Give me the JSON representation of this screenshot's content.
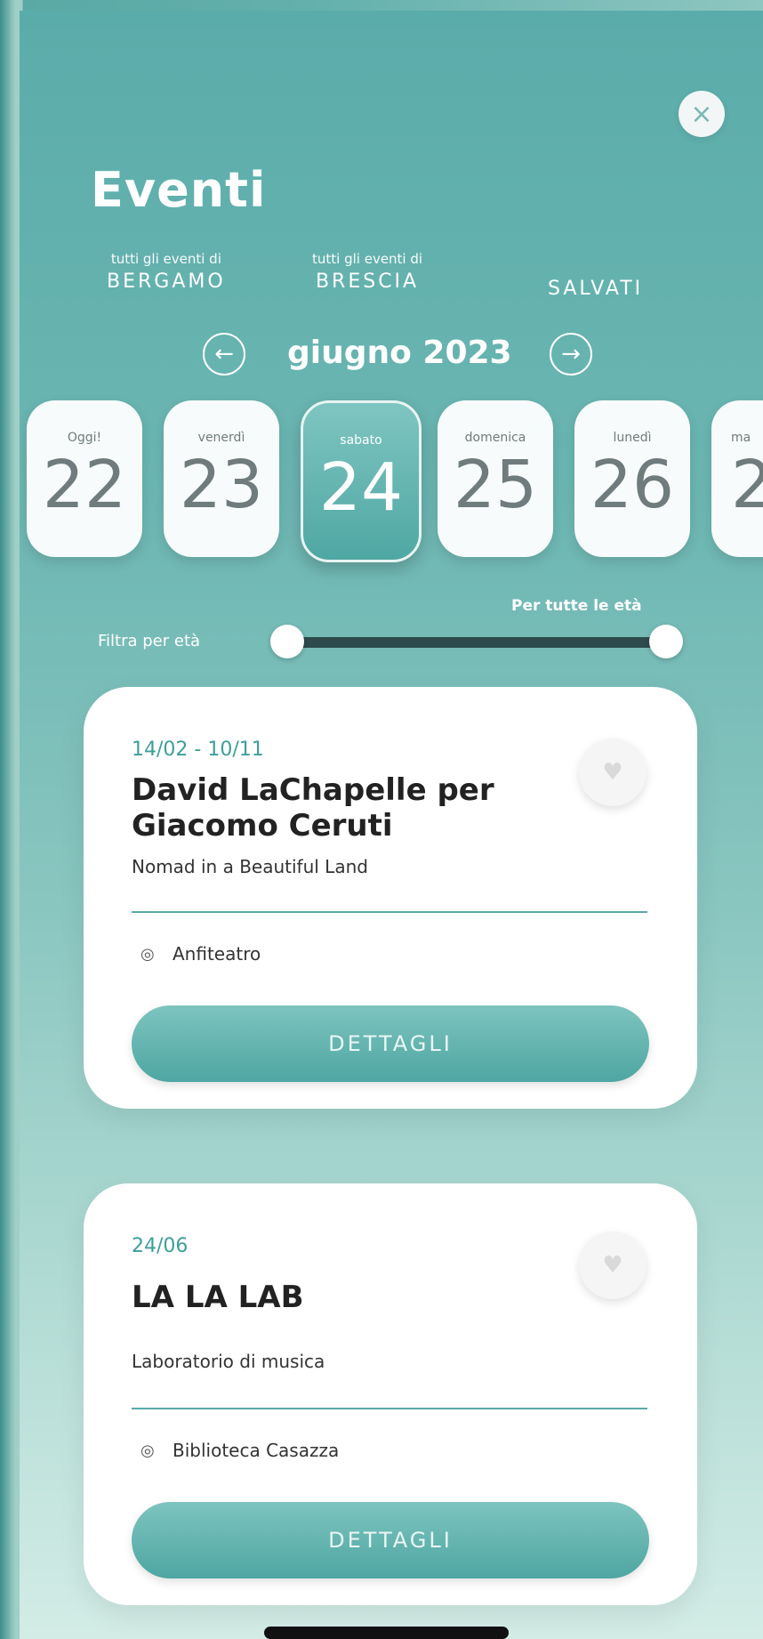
{
  "header": {
    "title": "Eventi",
    "close_icon": "close-icon",
    "tabs": [
      {
        "small": "tutti gli eventi di",
        "big": "BERGAMO"
      },
      {
        "small": "tutti gli eventi di",
        "big": "BRESCIA"
      },
      {
        "big": "SALVATI"
      }
    ]
  },
  "calendar": {
    "month": "giugno 2023",
    "days": [
      {
        "name": "Oggi!",
        "num": "22"
      },
      {
        "name": "venerdì",
        "num": "23"
      },
      {
        "name": "sabato",
        "num": "24",
        "selected": true
      },
      {
        "name": "domenica",
        "num": "25"
      },
      {
        "name": "lunedì",
        "num": "26"
      },
      {
        "name": "ma",
        "num": "2"
      }
    ]
  },
  "filter": {
    "label": "Filtra per età",
    "value": "Per tutte le età"
  },
  "events": [
    {
      "date": "14/02 - 10/11",
      "title": "David LaChapelle per Giacomo Ceruti",
      "subtitle": "Nomad in a Beautiful Land",
      "place": "Anfiteatro",
      "button": "DETTAGLI"
    },
    {
      "date": "24/06",
      "title": "LA LA LAB",
      "subtitle": "Laboratorio di musica",
      "place": "Biblioteca Casazza",
      "button": "DETTAGLI"
    }
  ],
  "colors": {
    "accent": "#4fa7a3",
    "slider_track": "#2d4a4c"
  }
}
